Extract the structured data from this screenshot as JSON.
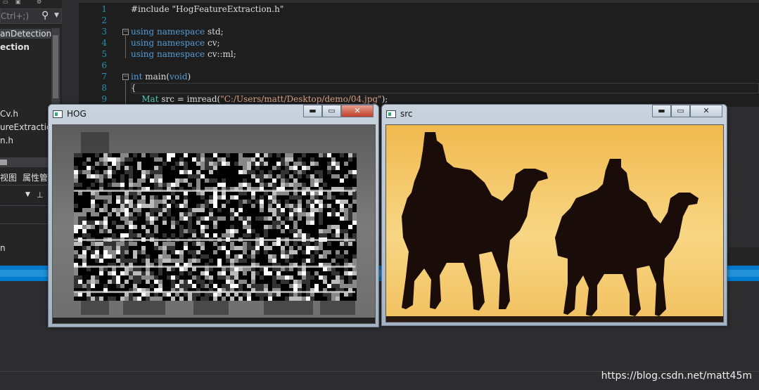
{
  "left_panel": {
    "search_placeholder": "Ctrl+;)",
    "items": [
      {
        "label": "anDetection",
        "bold": false
      },
      {
        "label": "ection",
        "bold": true
      },
      {
        "label": "Cv.h",
        "bold": false
      },
      {
        "label": "ureExtractio",
        "bold": false
      },
      {
        "label": "n.h",
        "bold": false
      }
    ],
    "tabs": [
      "视图",
      "属性管"
    ],
    "bottom_label": "n"
  },
  "editor": {
    "lines": [
      {
        "num": "1",
        "text": "#include \"HogFeatureExtraction.h\""
      },
      {
        "num": "2",
        "text": ""
      },
      {
        "num": "3",
        "text": "using namespace std;"
      },
      {
        "num": "4",
        "text": "using namespace cv;"
      },
      {
        "num": "5",
        "text": "using namespace cv::ml;"
      },
      {
        "num": "6",
        "text": ""
      },
      {
        "num": "7",
        "text": "int main(void)"
      },
      {
        "num": "8",
        "text": "{"
      },
      {
        "num": "9",
        "text": "Mat src = imread(\"C:/Users/matt/Desktop/demo/04.jpg\");"
      }
    ]
  },
  "windows": {
    "hog": {
      "title": "HOG",
      "minimize": "▬",
      "maximize": "▭",
      "close": "✕"
    },
    "src": {
      "title": "src",
      "minimize": "▬",
      "maximize": "▭",
      "close": "✕"
    }
  },
  "watermark": "https://blog.csdn.net/matt45m",
  "colors": {
    "editor_bg": "#1e1e1e",
    "ide_bg": "#2d2d30",
    "status_blue": "#007acc",
    "keyword": "#569cd6",
    "string": "#d69d85",
    "line_number": "#2b91af"
  }
}
